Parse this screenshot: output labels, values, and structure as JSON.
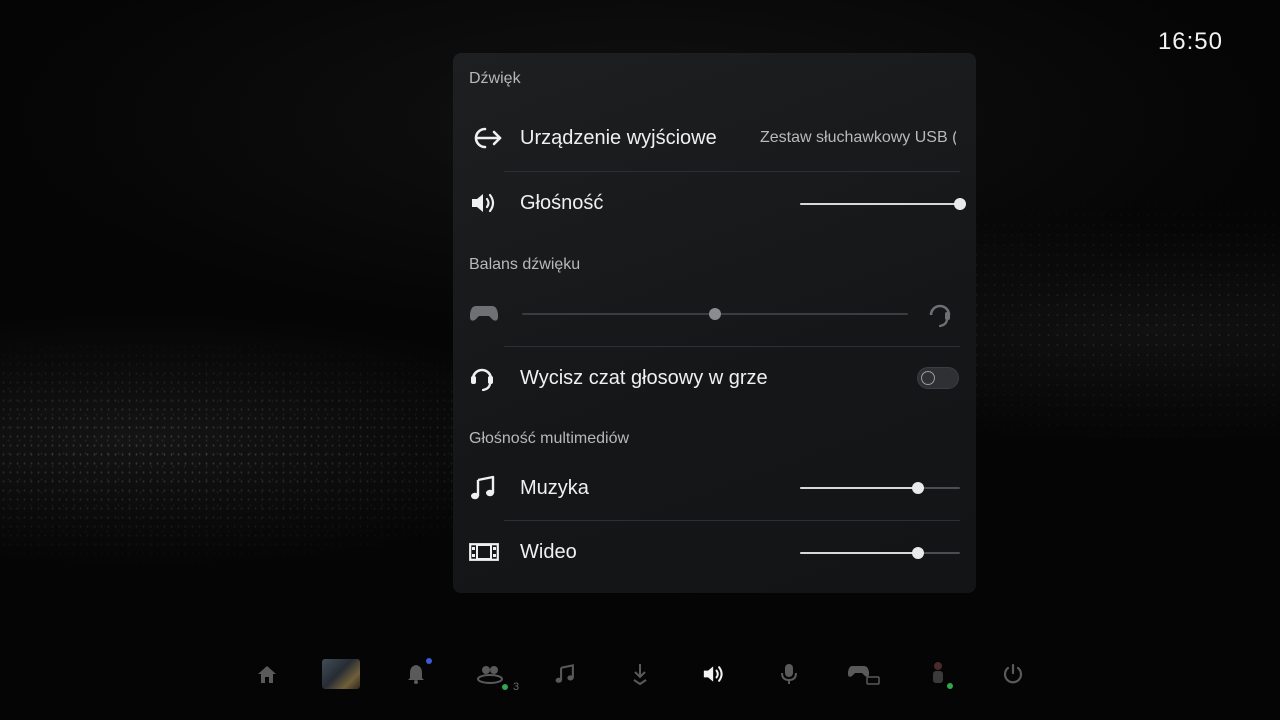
{
  "clock": {
    "time": "16:50"
  },
  "panel": {
    "title": "Dźwięk",
    "output_device": {
      "label": "Urządzenie wyjściowe",
      "value": "Zestaw słuchawkowy USB (",
      "icon": "output-arrow-icon"
    },
    "volume": {
      "label": "Głośność",
      "level": 1.0,
      "icon": "speaker-icon"
    },
    "balance": {
      "section_title": "Balans dźwięku",
      "position": 0.5,
      "left_icon": "controller-icon",
      "right_icon": "headset-icon"
    },
    "mute_chat": {
      "label": "Wycisz czat głosowy w grze",
      "enabled": false,
      "icon": "headset-icon"
    },
    "media": {
      "section_title": "Głośność multimediów",
      "music": {
        "label": "Muzyka",
        "level": 0.74,
        "icon": "music-note-icon"
      },
      "video": {
        "label": "Wideo",
        "level": 0.74,
        "icon": "film-icon"
      }
    }
  },
  "taskbar": {
    "items": [
      {
        "name": "home-icon",
        "active": false
      },
      {
        "name": "game-thumbnail",
        "active": false
      },
      {
        "name": "bell-icon",
        "active": false
      },
      {
        "name": "friends-icon",
        "active": false,
        "count": "3"
      },
      {
        "name": "music-note-icon",
        "active": false
      },
      {
        "name": "download-icon",
        "active": false
      },
      {
        "name": "speaker-icon",
        "active": true
      },
      {
        "name": "mic-icon",
        "active": false
      },
      {
        "name": "controller-battery-icon",
        "active": false
      },
      {
        "name": "accessibility-icon",
        "active": false
      },
      {
        "name": "power-icon",
        "active": false
      }
    ],
    "colors": {
      "active": "#f2f2f2",
      "inactive": "#5a5a5a",
      "online": "#2fa84f",
      "notify": "#3a5bd9"
    }
  }
}
